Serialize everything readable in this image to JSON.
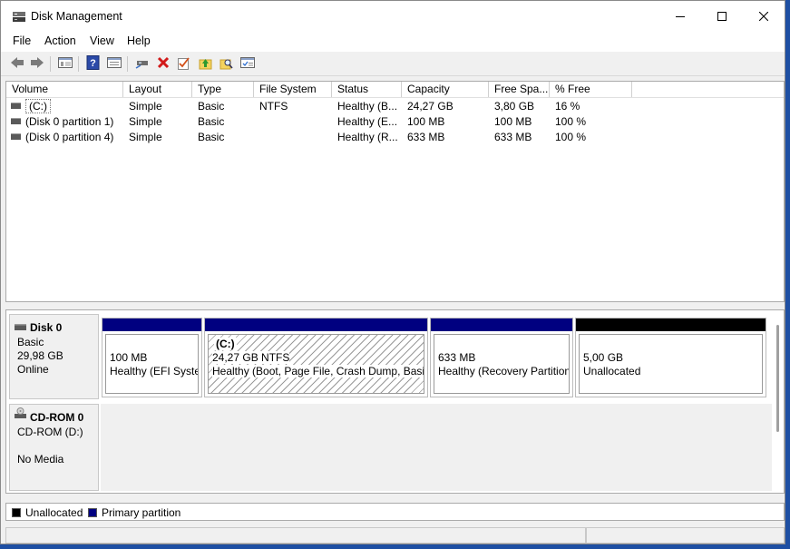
{
  "window": {
    "title": "Disk Management"
  },
  "menu": [
    "File",
    "Action",
    "View",
    "Help"
  ],
  "volume_list": {
    "columns": [
      "Volume",
      "Layout",
      "Type",
      "File System",
      "Status",
      "Capacity",
      "Free Spa...",
      "% Free"
    ],
    "rows": [
      {
        "volume": "(C:)",
        "layout": "Simple",
        "type": "Basic",
        "fs": "NTFS",
        "status": "Healthy (B...",
        "capacity": "24,27 GB",
        "free": "3,80 GB",
        "pct": "16 %"
      },
      {
        "volume": "(Disk 0 partition 1)",
        "layout": "Simple",
        "type": "Basic",
        "fs": "",
        "status": "Healthy (E...",
        "capacity": "100 MB",
        "free": "100 MB",
        "pct": "100 %"
      },
      {
        "volume": "(Disk 0 partition 4)",
        "layout": "Simple",
        "type": "Basic",
        "fs": "",
        "status": "Healthy (R...",
        "capacity": "633 MB",
        "free": "633 MB",
        "pct": "100 %"
      }
    ]
  },
  "disks": [
    {
      "name": "Disk 0",
      "type": "Basic",
      "size": "29,98 GB",
      "state": "Online",
      "partitions": [
        {
          "title": "",
          "size": "100 MB",
          "status": "Healthy (EFI System Partition)",
          "kind": "primary"
        },
        {
          "title": "(C:)",
          "size": "24,27 GB NTFS",
          "status": "Healthy (Boot, Page File, Crash Dump, Basic Data Partition)",
          "kind": "primary"
        },
        {
          "title": "",
          "size": "633 MB",
          "status": "Healthy (Recovery Partition)",
          "kind": "primary"
        },
        {
          "title": "",
          "size": "5,00 GB",
          "status": "Unallocated",
          "kind": "unallocated"
        }
      ]
    },
    {
      "name": "CD-ROM 0",
      "type": "CD-ROM (D:)",
      "state": "No Media"
    }
  ],
  "legend": [
    {
      "label": "Unallocated",
      "color": "#000000"
    },
    {
      "label": "Primary partition",
      "color": "#000080"
    }
  ],
  "colors": {
    "primary": "#000080",
    "unallocated": "#000000"
  }
}
